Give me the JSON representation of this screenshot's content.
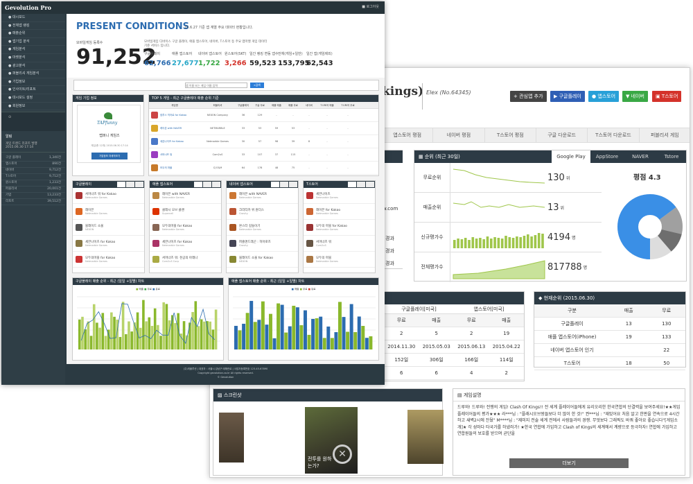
{
  "back": {
    "title": "kings)",
    "subtitle": "Elex (No.64345)",
    "buttons": [
      {
        "label": "+ 관심앱 추가",
        "color": "#444444"
      },
      {
        "label": "구글플레이",
        "color": "#2f5fb5"
      },
      {
        "label": "앱스토어",
        "color": "#28a0d8"
      },
      {
        "label": "네이버",
        "color": "#3aa845"
      },
      {
        "label": "T스토어",
        "color": "#d4332b"
      }
    ],
    "tabs": [
      "앱스토어 평점",
      "네이버 평점",
      "T스토어 평점",
      "구글 다운로드",
      "T스토어 다운로드",
      "퍼블리셔 게임"
    ],
    "left_tail": {
      "url": "w.com",
      "row1": "경과",
      "row2": "경과",
      "row3": "경과"
    },
    "stats": {
      "title": "순위 (최근 30일)",
      "tabs": [
        "Google Play",
        "AppStore",
        "NAVER",
        "Tstore"
      ],
      "rows": [
        {
          "label": "무료순위",
          "value": "130",
          "unit": "위"
        },
        {
          "label": "매출순위",
          "value": "13",
          "unit": "위"
        },
        {
          "label": "신규평가수",
          "value": "4194",
          "unit": "명"
        },
        {
          "label": "전체평가수",
          "value": "817788",
          "unit": "명"
        }
      ],
      "rating_label": "평점 4.3",
      "rating_value": 4.3
    },
    "rank_table": {
      "headers": [
        "구글플레이[미국]",
        "앱스토어[미국]"
      ],
      "sub": [
        "무료",
        "매출",
        "무료",
        "매출"
      ],
      "rows": [
        [
          "2",
          "5",
          "2",
          "19"
        ],
        [
          "2014.11.30",
          "2015.05.03",
          "2015.06.13",
          "2015.04.22"
        ],
        [
          "152일",
          "306일",
          "166일",
          "114일"
        ],
        [
          "6",
          "6",
          "4",
          "2"
        ]
      ]
    },
    "current_rank": {
      "title": "현재순위 (2015.06.30)",
      "headers": [
        "구분",
        "매출",
        "무료"
      ],
      "rows": [
        [
          "구글플레이",
          "13",
          "130"
        ],
        [
          "애플 앱스토어(iPhone)",
          "19",
          "133"
        ],
        [
          "네이버 앱스토어 인기",
          "",
          "22"
        ],
        [
          "T스토어",
          "18",
          "50"
        ]
      ]
    },
    "screenshots": {
      "title": "스크린샷",
      "caption": "전투를 원하는가?"
    },
    "description": {
      "title": "게임설명",
      "text": "드루와! 드루와! 전쟁의 게임! Clash Of Kings!! 전 세계 플레이어들에게 유리오리한 한국연합의 단결력을 보여주세요!★★게임 플레이어들의 평가★★★ 라***님 : \"플래시오브왕들보다 더 많이 한 것!\" 권***님 : \"재밌어요 처음 알고 한판을 연속으로 4시간하고 새벽2시에 잔뒀\" M****님 : \"제미지 전술 세계 전에서 사람들과의 경쟁. 무엇보다 그래픽도 바꿔 좋아요 좋습니다\"[게임소개]★ 각 성마다 타국가를 하냈러가! ★한국 연합에 가입하고 Clash of Kings의 세계에서 계량으로 등극하자! 연합에 가입하고 연합원들의 보호를 받으며 균단을",
      "more": "더보기"
    }
  },
  "front": {
    "brand": "Gevolution Pro",
    "user": "로그아웃",
    "sidebar_items": [
      "대시보드",
      "전체앱 랭킹",
      "매출순위",
      "앱기업 분석",
      "게임분석",
      "마켓분석",
      "광고분석",
      "퍼블리셔 게임분석",
      "기업정보",
      "인사이트/리포트",
      "대시보드 설정",
      "회원정보"
    ],
    "sidebar_box": {
      "title": "알림",
      "line1": "게임 트렌드 리포트 발행",
      "line2": "2015.06.30 17:14"
    },
    "sidebar_stats": [
      {
        "label": "구글 플레이",
        "value": "1,340건"
      },
      {
        "label": "앱스토어",
        "value": "890건"
      },
      {
        "label": "네이버",
        "value": "9,712건"
      },
      {
        "label": "T스토어",
        "value": "9,712건"
      },
      {
        "label": "원스토어",
        "value": "1,233건"
      },
      {
        "label": "퍼블리셔",
        "value": "20,001건"
      },
      {
        "label": "기업",
        "value": "13,233건"
      },
      {
        "label": "리포트",
        "value": "39,512건"
      }
    ],
    "heading": "PRESENT CONDITIONS",
    "heading_sub": "15.6.27 기준 앱 계열 주요 데이터 현황입니다.",
    "total_label": "모바일게임 등록수",
    "total_value": "91,252",
    "note": "모바일게임 디바이스 구글 플레이, 애플 앱스토어, 네이버, T스토어 등 주요 앱마켓 게임 데이터 기준 서비스 입니다.",
    "kpis": [
      {
        "label": "구글플레이",
        "value": "62,766",
        "color": "#2c6cb0"
      },
      {
        "label": "애플 앱스토어",
        "value": "27,677",
        "color": "#28a7c8"
      },
      {
        "label": "네이버 앱스토어",
        "value": "1,722",
        "color": "#3aa845"
      },
      {
        "label": "원스토어(SKT)",
        "value": "3,266",
        "color": "#d4332b"
      },
      {
        "label": "일간 랭킹 변동 앱수",
        "value": "59,523",
        "color": "#222222"
      },
      {
        "label": "전체(게임+일반)",
        "value": "153,795",
        "color": "#222222"
      },
      {
        "label": "일간 앱(게임제외)",
        "value": "62,543",
        "color": "#222222"
      }
    ],
    "search": {
      "placeholder": "앱 이름 또는 게임 이름 입력",
      "button": "검색"
    },
    "company": {
      "title": "게임 기업 정보",
      "logo": "TAPfunny",
      "name": "탭퍼니 게임즈",
      "meta": "게임(총 12개) 2015.06.30 17:14",
      "button": "기업정보 자세히보기"
    },
    "top_table": {
      "title": "TOP 5 게임 - 최근 구글플레이 매출 순위 기준",
      "headers": [
        "게임명",
        "퍼블리셔",
        "구글플레이",
        "구글 무료",
        "애플 매출",
        "애플 무료",
        "네이버",
        "T스토어 매출",
        "T스토어 무료"
      ],
      "rows": [
        [
          "컴투스 히어로 for Kakao",
          "NEXON Company",
          "36",
          "129",
          "-",
          "-",
          "-",
          "-",
          "-"
        ],
        [
          "레이븐 with NAVER",
          "NETMARBLE",
          "33",
          "53",
          "59",
          "53",
          "-",
          "-",
          "-"
        ],
        [
          "세븐나이츠 for Kakao",
          "Netmarble Games",
          "30",
          "57",
          "98",
          "39",
          "8",
          "-",
          "-"
        ],
        [
          "서머너즈 워",
          "Com2uS",
          "33",
          "107",
          "37",
          "115",
          "-",
          "-",
          "-"
        ],
        [
          "모두의 마블",
          "CJ E&M",
          "64",
          "178",
          "48",
          "75",
          "-",
          "-",
          "-"
        ]
      ]
    },
    "lists": [
      {
        "title": "구글플레이",
        "items": [
          [
            "서머너즈 워 for Kakao",
            "Netmarble Games"
          ],
          [
            "레이븐",
            "Netmarble Games"
          ],
          [
            "블레이드 소울",
            "NEXON"
          ],
          [
            "세븐나이츠 for Kakao",
            "Netmarble Games"
          ],
          [
            "모두의마블 for Kakao",
            "Netmarble Games"
          ]
        ]
      },
      {
        "title": "애플 앱스토어",
        "items": [
          [
            "레이븐 with NAVER",
            "Netmarble Games"
          ],
          [
            "클래시 오브 클랜",
            "Supercell"
          ],
          [
            "모두의마블 for Kakao",
            "Netmarble Games"
          ],
          [
            "세븐나이츠 for Kakao",
            "Netmarble Games"
          ],
          [
            "서머너즈 워: 천공의 아레나",
            "Com2uS Corp"
          ]
        ]
      },
      {
        "title": "네이버 앱스토어",
        "items": [
          [
            "레이븐 with NAVER",
            "Netmarble Games"
          ],
          [
            "크리티카 위 원더스",
            "Gravity"
          ],
          [
            "몬스터 길들이기",
            "Netmarble Games"
          ],
          [
            "퍼즐앤드래곤 : 히어로즈",
            "Gravity"
          ],
          [
            "블레이드 소울 for Kakao",
            "NEXON"
          ]
        ]
      },
      {
        "title": "T스토어",
        "items": [
          [
            "세븐나이츠",
            "Netmarble Games"
          ],
          [
            "레이븐 for Kakao",
            "Netmarble Games"
          ],
          [
            "모두의 마블 for Kakao",
            "Netmarble Games"
          ],
          [
            "서머너즈 워",
            "Com2uS"
          ],
          [
            "모두의 마블",
            "Netmarble Games"
          ]
        ]
      }
    ],
    "chart1": {
      "title": "구글플레이 매출 순위 - 최근 (일일 +일별) 차트",
      "legend": [
        "매출",
        "무료",
        "유료"
      ]
    },
    "chart2": {
      "title": "애플 앱스토어 매출 순위 - 최근 (일일 +일별) 차트",
      "legend": [
        "매출",
        "무료",
        "유료"
      ]
    },
    "footer": {
      "line1": "(주)게볼루션 | 대표자 : 서울시 강남구 테헤란로 | 사업자등록번호 123-45-67890",
      "line2": "Copyright gevolution.co.kr All rights reserved.",
      "line3": "© Gevolution"
    }
  }
}
